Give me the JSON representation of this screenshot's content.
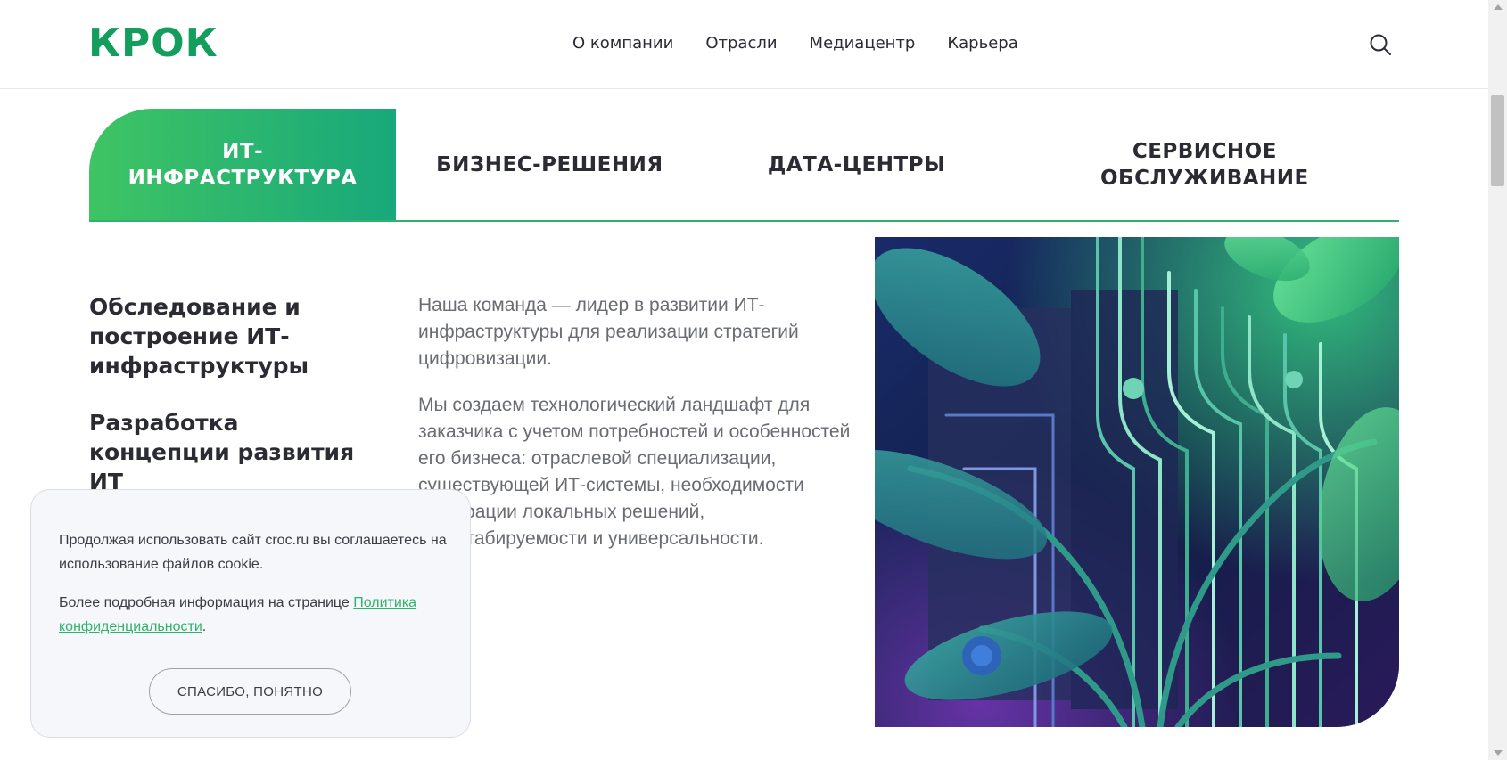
{
  "header": {
    "logo": "КРОК",
    "nav": [
      "О компании",
      "Отрасли",
      "Медиацентр",
      "Карьера"
    ],
    "search_icon": "search-icon"
  },
  "tabs": [
    {
      "label": "ИТ-ИНФРАСТРУКТУРА",
      "active": true
    },
    {
      "label": "БИЗНЕС-РЕШЕНИЯ",
      "active": false
    },
    {
      "label": "ДАТА-ЦЕНТРЫ",
      "active": false
    },
    {
      "label": "СЕРВИСНОЕ ОБСЛУЖИВАНИЕ",
      "active": false
    }
  ],
  "services": [
    "Обследование и построение ИТ-инфраструктуры",
    "Разработка концепции развития ИТ"
  ],
  "content": {
    "paragraph_1": "Наша команда — лидер в развитии ИТ-инфраструктуры для реализации стратегий цифровизации.",
    "paragraph_2": "Мы создаем технологический ландшафт для заказчика с учетом потребностей и особенностей его бизнеса: отраслевой специализации, существующей ИТ-системы, необходимости интеграции локальных решений, масштабируемости и универсальности."
  },
  "cookie": {
    "text_1": "Продолжая использовать сайт croc.ru вы соглашаетесь на использование файлов cookie.",
    "text_2_prefix": "Более подробная информация на странице ",
    "link": "Политика конфиденциальности",
    "text_2_suffix": ".",
    "button": "СПАСИБО, ПОНЯТНО"
  },
  "colors": {
    "brand": "#139e5d",
    "accent": "#2fb36c",
    "tab_gradient_start": "#3fc463",
    "tab_gradient_end": "#18a87b"
  }
}
